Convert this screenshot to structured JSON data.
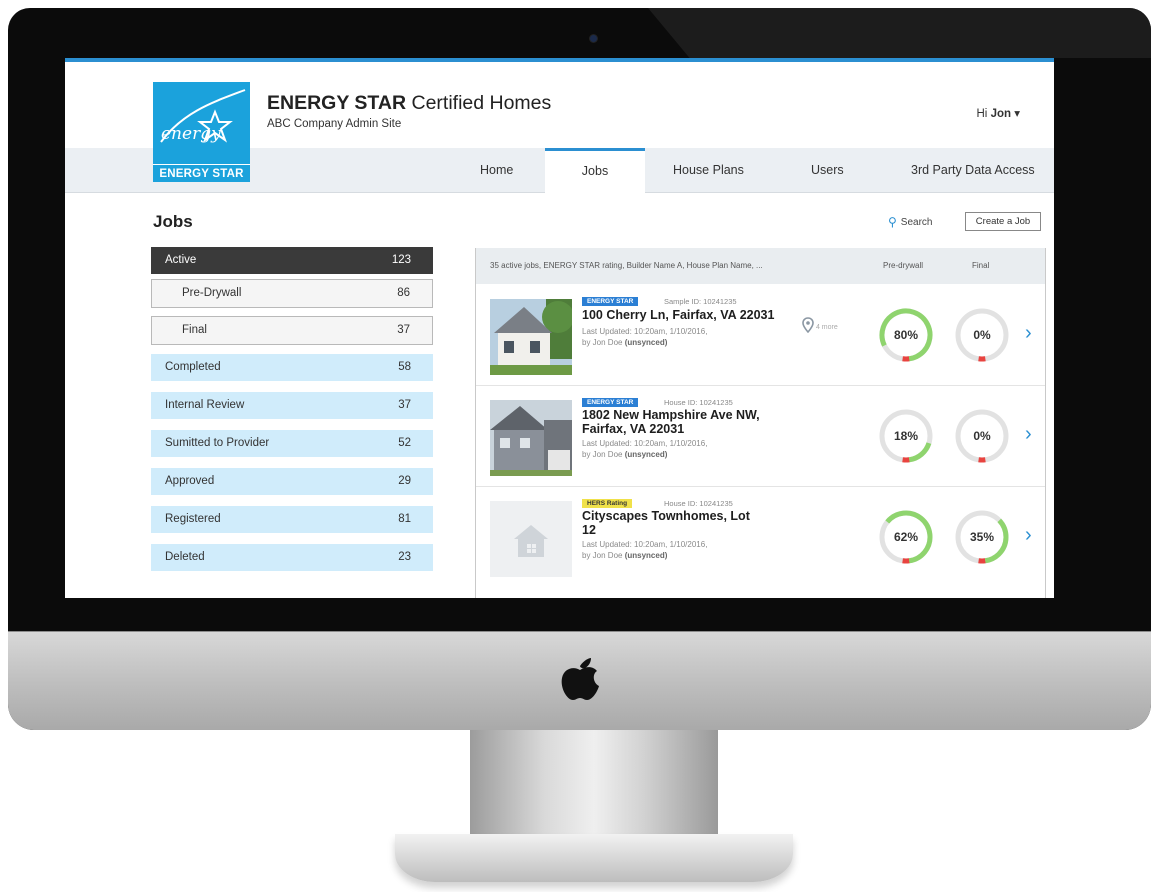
{
  "header": {
    "logo_text": "ENERGY STAR",
    "logo_script": "energy",
    "title_bold": "ENERGY STAR",
    "title_rest": " Certified Homes",
    "subtitle": "ABC Company Admin Site",
    "greeting": "Hi",
    "user_name": "Jon",
    "user_caret": "▾"
  },
  "nav": [
    {
      "label": "Home"
    },
    {
      "label": "Jobs",
      "active": true
    },
    {
      "label": "House Plans"
    },
    {
      "label": "Users"
    },
    {
      "label": "3rd Party Data Access"
    }
  ],
  "page": {
    "title": "Jobs",
    "search_label": "Search",
    "create_label": "Create a Job"
  },
  "statuses": [
    {
      "label": "Active",
      "count": "123"
    },
    {
      "label": "Pre-Drywall",
      "count": "86"
    },
    {
      "label": "Final",
      "count": "37"
    },
    {
      "label": "Completed",
      "count": "58"
    },
    {
      "label": "Internal Review",
      "count": "37"
    },
    {
      "label": "Sumitted to Provider",
      "count": "52"
    },
    {
      "label": "Approved",
      "count": "29"
    },
    {
      "label": "Registered",
      "count": "81"
    },
    {
      "label": "Deleted",
      "count": "23"
    }
  ],
  "jobs_header": {
    "summary": "35 active jobs, ENERGY STAR rating, Builder Name A, House Plan Name, ...",
    "col_pre": "Pre-drywall",
    "col_final": "Final"
  },
  "jobs": [
    {
      "badge": "ENERGY STAR",
      "id": "Sample ID: 10241235",
      "title": "100 Cherry Ln, Fairfax, VA 22031",
      "updated": "Last Updated: 10:20am, 1/10/2016,",
      "by": "by Jon Doe",
      "sync": "(unsynced)",
      "location": "4 more",
      "pre_drywall": {
        "label": "80%",
        "value": 0.8
      },
      "final": {
        "label": "0%",
        "value": 0.0
      }
    },
    {
      "badge": "ENERGY STAR",
      "id": "House ID: 10241235",
      "title": "1802 New Hampshire Ave NW, Fairfax, VA 22031",
      "updated": "Last Updated: 10:20am, 1/10/2016,",
      "by": "by Jon Doe",
      "sync": "(unsynced)",
      "pre_drywall": {
        "label": "18%",
        "value": 0.18
      },
      "final": {
        "label": "0%",
        "value": 0.0
      }
    },
    {
      "badge": "HERS Rating",
      "id": "House ID: 10241235",
      "title": "Cityscapes Townhomes, Lot 12",
      "updated": "Last Updated: 10:20am, 1/10/2016,",
      "by": "by Jon Doe",
      "sync": "(unsynced)",
      "pre_drywall": {
        "label": "62%",
        "value": 0.62
      },
      "final": {
        "label": "35%",
        "value": 0.35
      }
    }
  ],
  "colors": {
    "accent": "#2b8fd1",
    "progress_green": "#8fd46e",
    "progress_red": "#e8433f",
    "status_blue": "#d0ecfb",
    "active_dark": "#3a3a3a"
  }
}
